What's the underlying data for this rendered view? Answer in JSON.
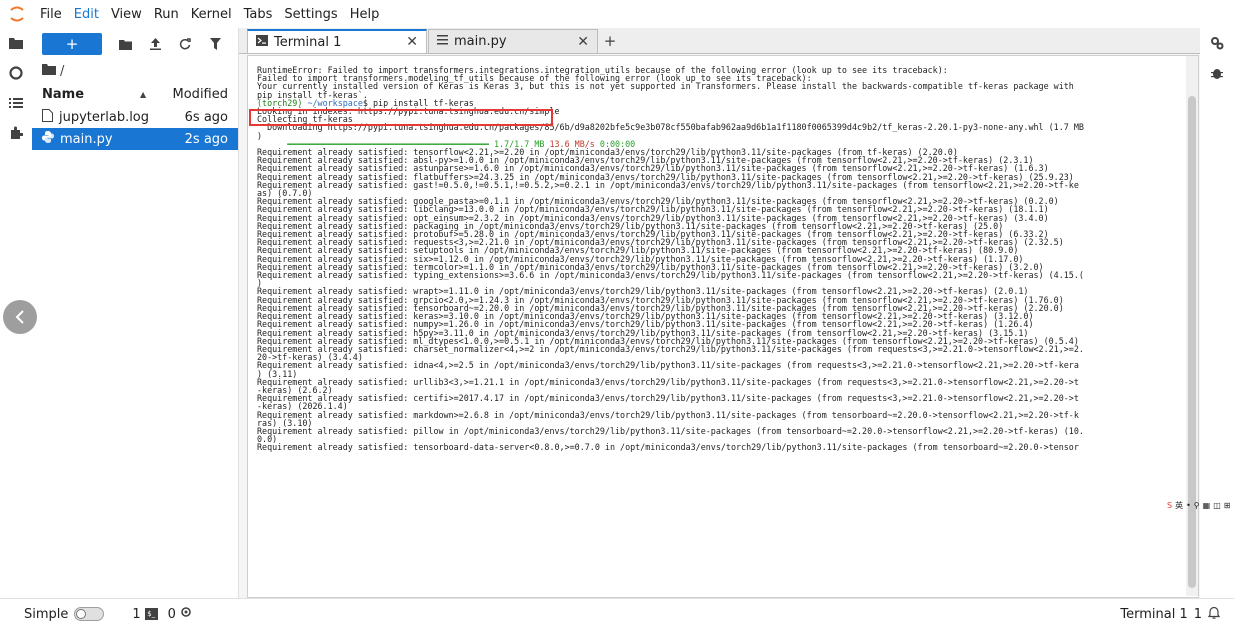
{
  "menubar": {
    "items": [
      "File",
      "Edit",
      "View",
      "Run",
      "Kernel",
      "Tabs",
      "Settings",
      "Help"
    ]
  },
  "filebrowser": {
    "new_label": "+",
    "path": "/",
    "col_name": "Name",
    "col_modified": "Modified",
    "files": [
      {
        "name": "jupyterlab.log",
        "modified": "6s ago",
        "icon": "file-icon"
      },
      {
        "name": "main.py",
        "modified": "2s ago",
        "icon": "python-icon"
      }
    ]
  },
  "tabs": [
    {
      "label": "Terminal 1",
      "icon": "terminal-icon"
    },
    {
      "label": "main.py",
      "icon": "text-file-icon"
    }
  ],
  "terminal": {
    "prompt_env": "(torch29)",
    "prompt_path": "~/workspace",
    "prompt_cmd": "$ pip install tf-keras",
    "progress_bar": "━━━━━━━━━━━━━━━━━━━━━━━━━━━━━━━━━━━━━━━━",
    "progress_size": "1.7/1.7 MB",
    "progress_rate": "13.6 MB/s",
    "progress_eta": "0:00:00",
    "lines_before": [
      "RuntimeError: Failed to import transformers.integrations.integration_utils because of the following error (look up to see its traceback):",
      "Failed to import transformers.modeling_tf_utils because of the following error (look up to see its traceback):",
      "Your currently installed version of Keras is Keras 3, but this is not yet supported in Transformers. Please install the backwards-compatible tf-keras package with",
      "pip install tf-keras`."
    ],
    "lines_middle": [
      "Looking in indexes: https://pypi.tuna.tsinghua.edu.cn/simple",
      "Collecting tf-keras",
      "  Downloading https://pypi.tuna.tsinghua.edu.cn/packages/85/6b/d9a8202bfe5c9e3b078cf550bafab962aa9d6b1a1f1180f0065399d4c9b2/tf_keras-2.20.1-py3-none-any.whl (1.7 MB",
      ")"
    ],
    "lines_after": [
      "Requirement already satisfied: tensorflow<2.21,>=2.20 in /opt/miniconda3/envs/torch29/lib/python3.11/site-packages (from tf-keras) (2.20.0)",
      "Requirement already satisfied: absl-py>=1.0.0 in /opt/miniconda3/envs/torch29/lib/python3.11/site-packages (from tensorflow<2.21,>=2.20->tf-keras) (2.3.1)",
      "Requirement already satisfied: astunparse>=1.6.0 in /opt/miniconda3/envs/torch29/lib/python3.11/site-packages (from tensorflow<2.21,>=2.20->tf-keras) (1.6.3)",
      "Requirement already satisfied: flatbuffers>=24.3.25 in /opt/miniconda3/envs/torch29/lib/python3.11/site-packages (from tensorflow<2.21,>=2.20->tf-keras) (25.9.23)",
      "Requirement already satisfied: gast!=0.5.0,!=0.5.1,!=0.5.2,>=0.2.1 in /opt/miniconda3/envs/torch29/lib/python3.11/site-packages (from tensorflow<2.21,>=2.20->tf-ke",
      "as) (0.7.0)",
      "Requirement already satisfied: google_pasta>=0.1.1 in /opt/miniconda3/envs/torch29/lib/python3.11/site-packages (from tensorflow<2.21,>=2.20->tf-keras) (0.2.0)",
      "Requirement already satisfied: libclang>=13.0.0 in /opt/miniconda3/envs/torch29/lib/python3.11/site-packages (from tensorflow<2.21,>=2.20->tf-keras) (18.1.1)",
      "Requirement already satisfied: opt_einsum>=2.3.2 in /opt/miniconda3/envs/torch29/lib/python3.11/site-packages (from tensorflow<2.21,>=2.20->tf-keras) (3.4.0)",
      "Requirement already satisfied: packaging in /opt/miniconda3/envs/torch29/lib/python3.11/site-packages (from tensorflow<2.21,>=2.20->tf-keras) (25.0)",
      "Requirement already satisfied: protobuf>=5.28.0 in /opt/miniconda3/envs/torch29/lib/python3.11/site-packages (from tensorflow<2.21,>=2.20->tf-keras) (6.33.2)",
      "Requirement already satisfied: requests<3,>=2.21.0 in /opt/miniconda3/envs/torch29/lib/python3.11/site-packages (from tensorflow<2.21,>=2.20->tf-keras) (2.32.5)",
      "Requirement already satisfied: setuptools in /opt/miniconda3/envs/torch29/lib/python3.11/site-packages (from tensorflow<2.21,>=2.20->tf-keras) (80.9.0)",
      "Requirement already satisfied: six>=1.12.0 in /opt/miniconda3/envs/torch29/lib/python3.11/site-packages (from tensorflow<2.21,>=2.20->tf-keras) (1.17.0)",
      "Requirement already satisfied: termcolor>=1.1.0 in /opt/miniconda3/envs/torch29/lib/python3.11/site-packages (from tensorflow<2.21,>=2.20->tf-keras) (3.2.0)",
      "Requirement already satisfied: typing_extensions>=3.6.6 in /opt/miniconda3/envs/torch29/lib/python3.11/site-packages (from tensorflow<2.21,>=2.20->tf-keras) (4.15.(",
      ")",
      "Requirement already satisfied: wrapt>=1.11.0 in /opt/miniconda3/envs/torch29/lib/python3.11/site-packages (from tensorflow<2.21,>=2.20->tf-keras) (2.0.1)",
      "Requirement already satisfied: grpcio<2.0,>=1.24.3 in /opt/miniconda3/envs/torch29/lib/python3.11/site-packages (from tensorflow<2.21,>=2.20->tf-keras) (1.76.0)",
      "Requirement already satisfied: tensorboard~=2.20.0 in /opt/miniconda3/envs/torch29/lib/python3.11/site-packages (from tensorflow<2.21,>=2.20->tf-keras) (2.20.0)",
      "Requirement already satisfied: keras>=3.10.0 in /opt/miniconda3/envs/torch29/lib/python3.11/site-packages (from tensorflow<2.21,>=2.20->tf-keras) (3.12.0)",
      "Requirement already satisfied: numpy>=1.26.0 in /opt/miniconda3/envs/torch29/lib/python3.11/site-packages (from tensorflow<2.21,>=2.20->tf-keras) (1.26.4)",
      "Requirement already satisfied: h5py>=3.11.0 in /opt/miniconda3/envs/torch29/lib/python3.11/site-packages (from tensorflow<2.21,>=2.20->tf-keras) (3.15.1)",
      "Requirement already satisfied: ml_dtypes<1.0.0,>=0.5.1 in /opt/miniconda3/envs/torch29/lib/python3.11/site-packages (from tensorflow<2.21,>=2.20->tf-keras) (0.5.4)",
      "Requirement already satisfied: charset_normalizer<4,>=2 in /opt/miniconda3/envs/torch29/lib/python3.11/site-packages (from requests<3,>=2.21.0->tensorflow<2.21,>=2.",
      "20->tf-keras) (3.4.4)",
      "Requirement already satisfied: idna<4,>=2.5 in /opt/miniconda3/envs/torch29/lib/python3.11/site-packages (from requests<3,>=2.21.0->tensorflow<2.21,>=2.20->tf-kera",
      ") (3.11)",
      "Requirement already satisfied: urllib3<3,>=1.21.1 in /opt/miniconda3/envs/torch29/lib/python3.11/site-packages (from requests<3,>=2.21.0->tensorflow<2.21,>=2.20->t",
      "-keras) (2.6.2)",
      "Requirement already satisfied: certifi>=2017.4.17 in /opt/miniconda3/envs/torch29/lib/python3.11/site-packages (from requests<3,>=2.21.0->tensorflow<2.21,>=2.20->t",
      "-keras) (2026.1.4)",
      "Requirement already satisfied: markdown>=2.6.8 in /opt/miniconda3/envs/torch29/lib/python3.11/site-packages (from tensorboard~=2.20.0->tensorflow<2.21,>=2.20->tf-k",
      "ras) (3.10)",
      "Requirement already satisfied: pillow in /opt/miniconda3/envs/torch29/lib/python3.11/site-packages (from tensorboard~=2.20.0->tensorflow<2.21,>=2.20->tf-keras) (10.",
      "0.0)",
      "Requirement already satisfied: tensorboard-data-server<0.8.0,>=0.7.0 in /opt/miniconda3/envs/torch29/lib/python3.11/site-packages (from tensorboard~=2.20.0->tensor"
    ]
  },
  "statusbar": {
    "simple_label": "Simple",
    "terminals_count": "1",
    "kernels_count": "0",
    "right_label": "Terminal 1",
    "right_count": "1"
  },
  "colors": {
    "accent": "#1976d2",
    "highlight_box": "#e53935"
  }
}
